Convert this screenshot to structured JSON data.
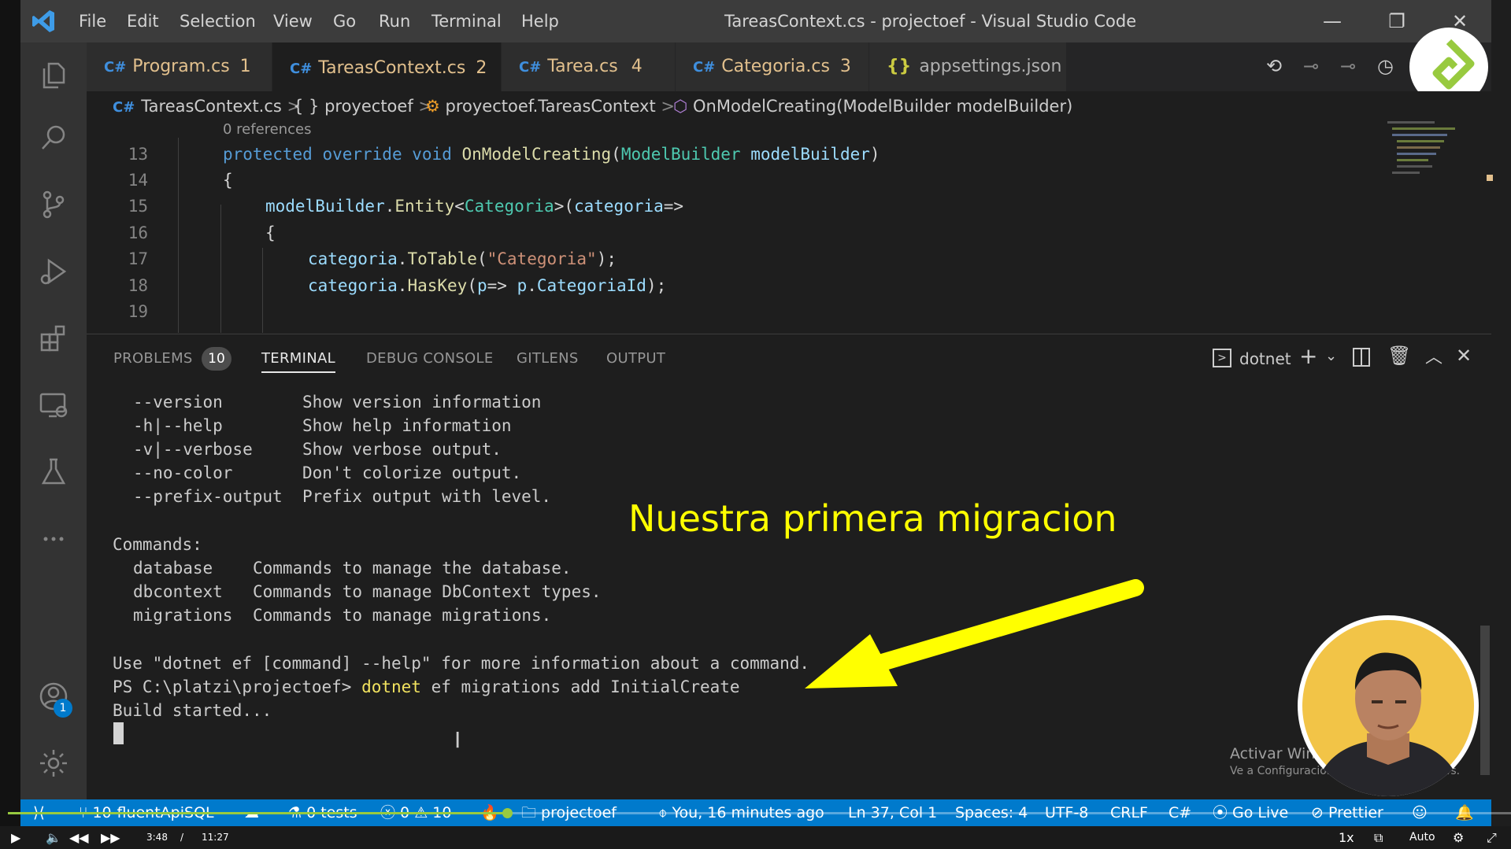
{
  "window": {
    "title": "TareasContext.cs - projectoef - Visual Studio Code"
  },
  "menu": [
    "File",
    "Edit",
    "Selection",
    "View",
    "Go",
    "Run",
    "Terminal",
    "Help"
  ],
  "tabs": [
    {
      "label": "Program.cs",
      "badge": "1",
      "color": "#e2c08d"
    },
    {
      "label": "TareasContext.cs",
      "badge": "2",
      "color": "#e2c08d"
    },
    {
      "label": "Tarea.cs",
      "badge": "4",
      "color": "#e2c08d"
    },
    {
      "label": "Categoria.cs",
      "badge": "3",
      "color": "#e2c08d"
    },
    {
      "label": "appsettings.json",
      "badge": "",
      "color": "#b0b0b0"
    }
  ],
  "breadcrumb": {
    "file": "TareasContext.cs",
    "namespace": "{ } proyectoef",
    "class": "proyectoef.TareasContext",
    "method": "OnModelCreating(ModelBuilder modelBuilder)"
  },
  "editor": {
    "codelens": "0 references",
    "line_numbers": [
      "13",
      "14",
      "15",
      "16",
      "17",
      "18",
      "19"
    ]
  },
  "panel": {
    "tabs": [
      "PROBLEMS",
      "TERMINAL",
      "DEBUG CONSOLE",
      "GITLENS",
      "OUTPUT"
    ],
    "problems_count": "10",
    "terminal_name": "dotnet"
  },
  "terminal": {
    "options": [
      {
        "flag": "--version",
        "desc": "Show version information"
      },
      {
        "flag": "-h|--help",
        "desc": "Show help information"
      },
      {
        "flag": "-v|--verbose",
        "desc": "Show verbose output."
      },
      {
        "flag": "--no-color",
        "desc": "Don't colorize output."
      },
      {
        "flag": "--prefix-output",
        "desc": "Prefix output with level."
      }
    ],
    "commands_header": "Commands:",
    "commands": [
      {
        "name": "database",
        "desc": "Commands to manage the database."
      },
      {
        "name": "dbcontext",
        "desc": "Commands to manage DbContext types."
      },
      {
        "name": "migrations",
        "desc": "Commands to manage migrations."
      }
    ],
    "help_line": "Use \"dotnet ef [command] --help\" for more information about a command.",
    "prompt": "PS C:\\platzi\\projectoef>",
    "cmd_exe": "dotnet",
    "cmd_args": "ef migrations add InitialCreate",
    "build_line": "Build started..."
  },
  "overlay": {
    "caption": "Nuestra primera migracion",
    "caption_color": "#ffff00",
    "watermark_title": "Activar Windows",
    "watermark_sub": "Ve a Configuración para activar Windows."
  },
  "statusbar": {
    "branch": "10-fluentApiSQL",
    "tests": "0 tests",
    "errors": "0",
    "warnings": "10",
    "folder": "projectoef",
    "blame": "You, 16 minutes ago",
    "position": "Ln 37, Col 1",
    "spaces": "Spaces: 4",
    "encoding": "UTF-8",
    "eol": "CRLF",
    "language": "C#",
    "golive": "Go Live",
    "prettier": "Prettier"
  },
  "accounts_badge": "1",
  "video": {
    "current_time": "3:48",
    "separator": "/",
    "duration": "11:27",
    "speed": "1x",
    "quality": "Auto",
    "progress_fraction": 0.332
  }
}
